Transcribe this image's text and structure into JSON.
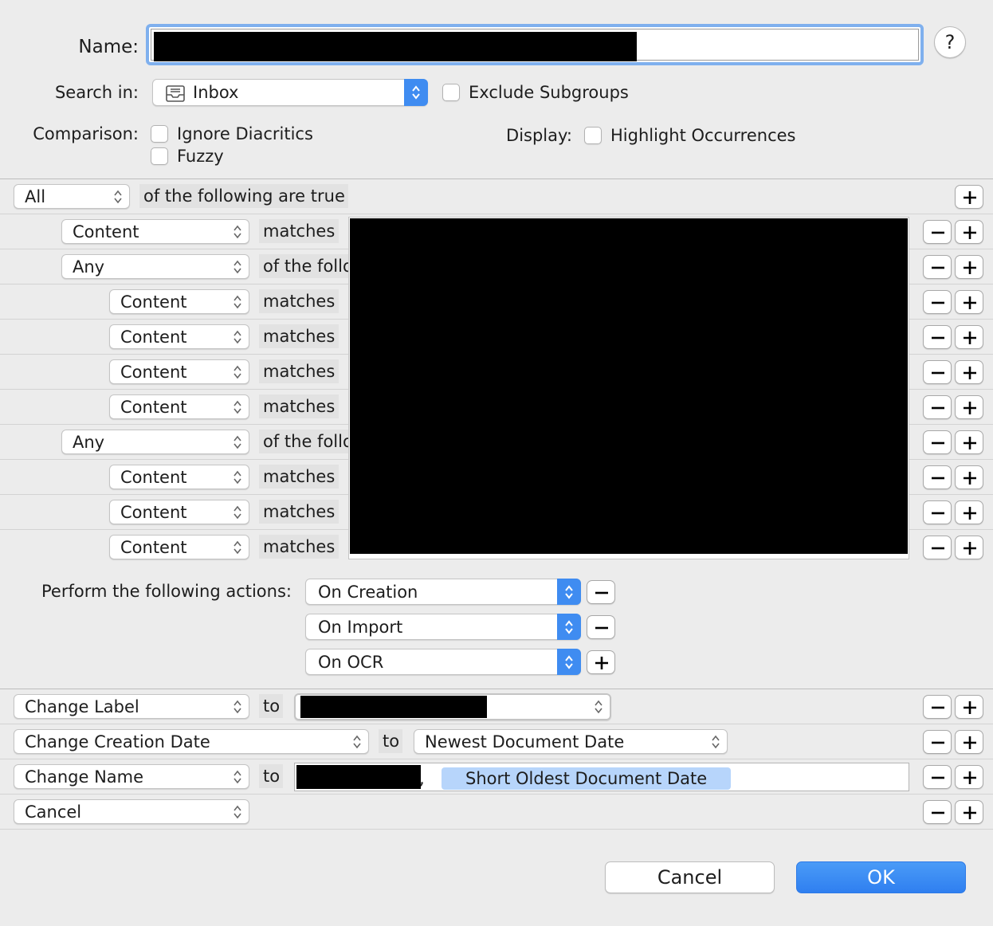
{
  "header": {
    "name_label": "Name:",
    "help_label": "?",
    "search_in_label": "Search in:",
    "search_in_value": "Inbox",
    "exclude_subgroups_label": "Exclude Subgroups",
    "comparison_label": "Comparison:",
    "ignore_diacritics_label": "Ignore Diacritics",
    "fuzzy_label": "Fuzzy",
    "display_label": "Display:",
    "highlight_label": "Highlight Occurrences"
  },
  "criteria": {
    "root_quantifier": "All",
    "root_text": "of the following are true",
    "rows": [
      {
        "field": "Content",
        "op": "matches"
      },
      {
        "field": "Any",
        "op": "of the following are true"
      },
      {
        "field": "Content",
        "op": "matches"
      },
      {
        "field": "Content",
        "op": "matches"
      },
      {
        "field": "Content",
        "op": "matches"
      },
      {
        "field": "Content",
        "op": "matches"
      },
      {
        "field": "Any",
        "op": "of the following are true"
      },
      {
        "field": "Content",
        "op": "matches"
      },
      {
        "field": "Content",
        "op": "matches"
      },
      {
        "field": "Content",
        "op": "matches"
      }
    ]
  },
  "triggers": {
    "label": "Perform the following actions:",
    "items": [
      "On Creation",
      "On Import",
      "On OCR"
    ]
  },
  "actions": {
    "to_label": "to",
    "rows": [
      {
        "action": "Change Label"
      },
      {
        "action": "Change Creation Date",
        "value": "Newest Document Date"
      },
      {
        "action": "Change Name",
        "name_suffix": ", ",
        "token": "Short Oldest Document Date"
      },
      {
        "action": "Cancel"
      }
    ]
  },
  "footer": {
    "cancel_label": "Cancel",
    "ok_label": "OK"
  }
}
